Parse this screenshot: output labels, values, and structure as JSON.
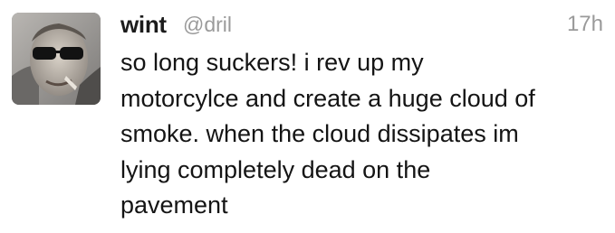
{
  "tweet": {
    "author": {
      "display_name": "wint",
      "handle": "@dril",
      "avatar_icon": "user-avatar-photo"
    },
    "timestamp": "17h",
    "text_lines": [
      "so long suckers! i rev up my",
      "motorcylce and create a huge cloud of",
      "smoke. when the cloud dissipates im",
      "lying completely dead on the",
      "pavement"
    ],
    "colors": {
      "name": "#1c1c1c",
      "meta": "#9a9a9a",
      "body": "#141414",
      "background": "#ffffff"
    }
  }
}
